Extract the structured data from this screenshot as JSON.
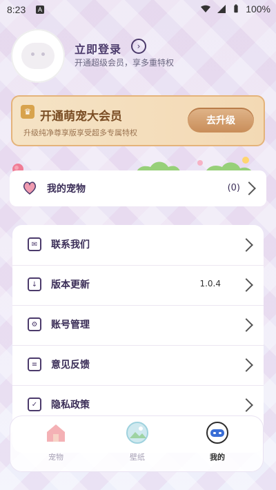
{
  "status_bar": {
    "time": "8:23",
    "app_badge": "A",
    "battery": "100%"
  },
  "profile": {
    "login_title": "立即登录",
    "login_subtitle": "开通超级会员，享多重特权"
  },
  "vip": {
    "title": "开通萌宠大会员",
    "subtitle": "升级纯净尊享版享受超多专属特权",
    "button": "去升级"
  },
  "pets": {
    "label": "我的宠物",
    "count": "(0)"
  },
  "menu": {
    "items": [
      {
        "label": "联系我们",
        "value": ""
      },
      {
        "label": "版本更新",
        "value": "1.0.4"
      },
      {
        "label": "账号管理",
        "value": ""
      },
      {
        "label": "意见反馈",
        "value": ""
      },
      {
        "label": "隐私政策",
        "value": ""
      }
    ]
  },
  "nav": {
    "items": [
      {
        "label": "宠物"
      },
      {
        "label": "壁纸"
      },
      {
        "label": "我的"
      }
    ]
  }
}
